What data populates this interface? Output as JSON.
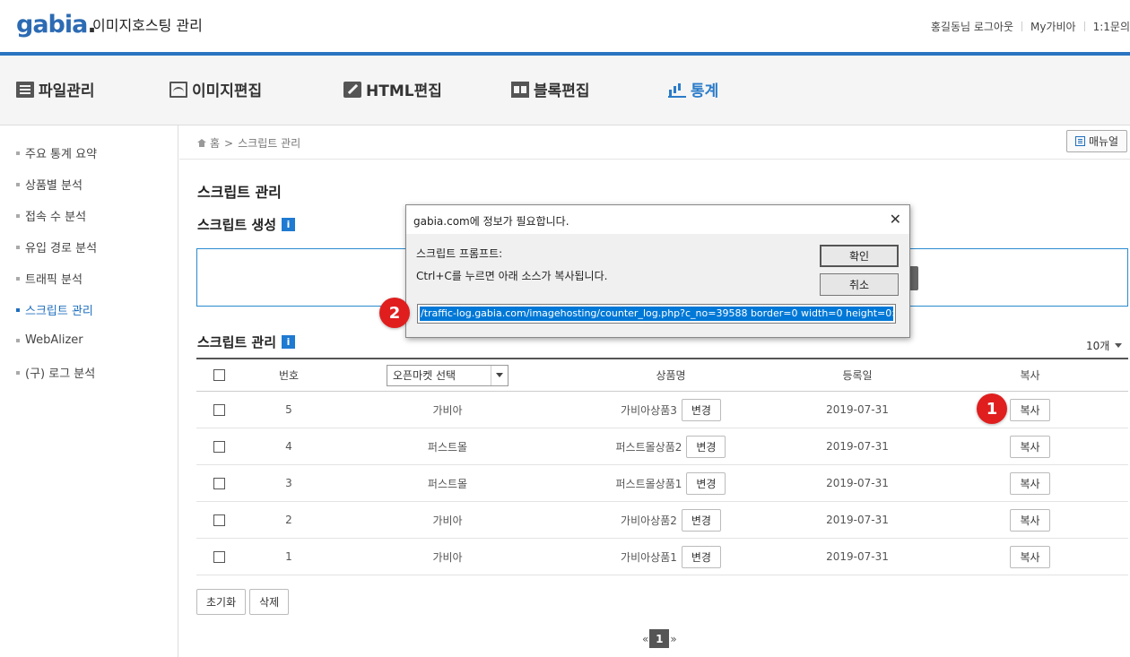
{
  "header": {
    "logo": "gabia",
    "logo_dot": ".",
    "app_title": "이미지호스팅 관리",
    "links": [
      "홍길동님 로그아웃",
      "My가비아",
      "1:1문의"
    ]
  },
  "nav": {
    "items": [
      {
        "label": "파일관리",
        "icon": "file-list-icon"
      },
      {
        "label": "이미지편집",
        "icon": "image-icon"
      },
      {
        "label": "HTML편집",
        "icon": "pencil-icon"
      },
      {
        "label": "블록편집",
        "icon": "block-icon"
      },
      {
        "label": "통계",
        "icon": "bar-chart-icon",
        "active": true
      }
    ]
  },
  "sidebar": {
    "items": [
      {
        "label": "주요 통계 요약"
      },
      {
        "label": "상품별 분석"
      },
      {
        "label": "접속 수 분석"
      },
      {
        "label": "유입 경로 분석"
      },
      {
        "label": "트래픽 분석"
      },
      {
        "label": "스크립트 관리",
        "active": true
      },
      {
        "label": "WebAlizer"
      },
      {
        "label": "(구) 로그 분석"
      }
    ]
  },
  "breadcrumb": {
    "home": "홈",
    "sep": ">",
    "current": "스크립트 관리"
  },
  "manual_button": "매뉴얼",
  "page_title": "스크립트 관리",
  "section_create": {
    "title": "스크립트 생성",
    "info": "i"
  },
  "section_list": {
    "title": "스크립트 관리",
    "info": "i"
  },
  "per_page": "10개",
  "table": {
    "headers": {
      "no": "번호",
      "market_select": "오픈마켓 선택",
      "product": "상품명",
      "date": "등록일",
      "copy": "복사"
    },
    "rows": [
      {
        "no": "5",
        "market": "가비아",
        "product": "가비아상품3",
        "change": "변경",
        "date": "2019-07-31",
        "copy": "복사"
      },
      {
        "no": "4",
        "market": "퍼스트몰",
        "product": "퍼스트몰상품2",
        "change": "변경",
        "date": "2019-07-31",
        "copy": "복사"
      },
      {
        "no": "3",
        "market": "퍼스트몰",
        "product": "퍼스트몰상품1",
        "change": "변경",
        "date": "2019-07-31",
        "copy": "복사"
      },
      {
        "no": "2",
        "market": "가비아",
        "product": "가비아상품2",
        "change": "변경",
        "date": "2019-07-31",
        "copy": "복사"
      },
      {
        "no": "1",
        "market": "가비아",
        "product": "가비아상품1",
        "change": "변경",
        "date": "2019-07-31",
        "copy": "복사"
      }
    ]
  },
  "bottom_buttons": {
    "reset": "초기화",
    "delete": "삭제"
  },
  "pager": {
    "prev": "«",
    "current": "1",
    "next": "»"
  },
  "dialog": {
    "title": "gabia.com에 정보가 필요합니다.",
    "close": "✕",
    "label1": "스크립트 프롬프트:",
    "label2": "Ctrl+C를 누르면 아래 소스가 복사됩니다.",
    "ok": "확인",
    "cancel": "취소",
    "input_value": "/traffic-log.gabia.com/imagehosting/counter_log.php?c_no=39588 border=0 width=0  height=0>"
  },
  "badges": {
    "one": "1",
    "two": "2"
  },
  "colors": {
    "brand_blue": "#2a74c1",
    "active_blue": "#2a7bc9",
    "badge_red": "#e01e1e",
    "selection_blue": "#0078d7"
  }
}
